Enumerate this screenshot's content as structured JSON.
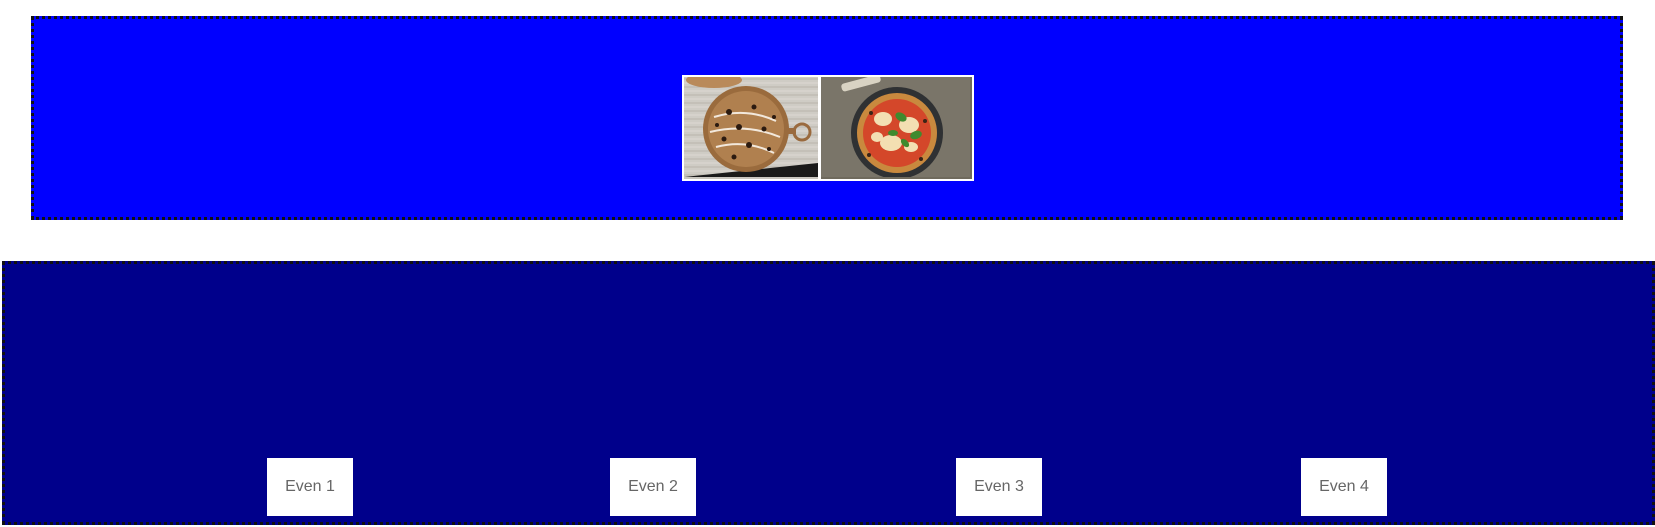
{
  "top_section": {
    "background_color": "#0000ff",
    "images": [
      {
        "subject": "cookie-pizza-on-wooden-board"
      },
      {
        "subject": "margherita-pizza-with-basil"
      }
    ]
  },
  "bottom_section": {
    "background_color": "#00008b",
    "cards": [
      {
        "label": "Even 1"
      },
      {
        "label": "Even 2"
      },
      {
        "label": "Even 3"
      },
      {
        "label": "Even 4"
      }
    ]
  }
}
